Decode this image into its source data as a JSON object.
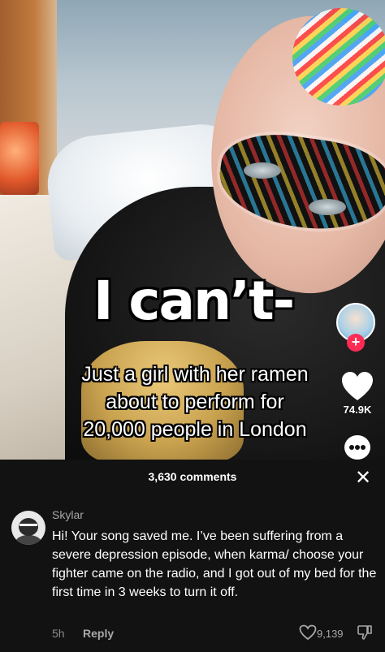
{
  "video": {
    "overlay_caption": "I can’t-",
    "subtitle_lines": [
      "Just a girl with her ramen",
      "about to perform for",
      "20,000 people in London"
    ]
  },
  "rail": {
    "follow_symbol": "+",
    "like_count": "74.9K",
    "icons": [
      "creator-avatar",
      "follow-plus-icon",
      "heart-icon",
      "comment-icon"
    ]
  },
  "comments_panel": {
    "count_label": "3,630 comments",
    "close_symbol": "✕",
    "comment": {
      "username": "Skylar",
      "text": "Hi! Your song saved me. I’ve been suffering from a severe depression episode, when karma/ choose your fighter came on the radio, and I got out of my bed for the first time in 3 weeks to turn it off.",
      "time": "5h",
      "reply_label": "Reply",
      "like_count": "9,139"
    }
  },
  "colors": {
    "sheet_background": "#121212",
    "accent_pink": "#fe2c55",
    "muted_text": "#a8a8a8"
  }
}
